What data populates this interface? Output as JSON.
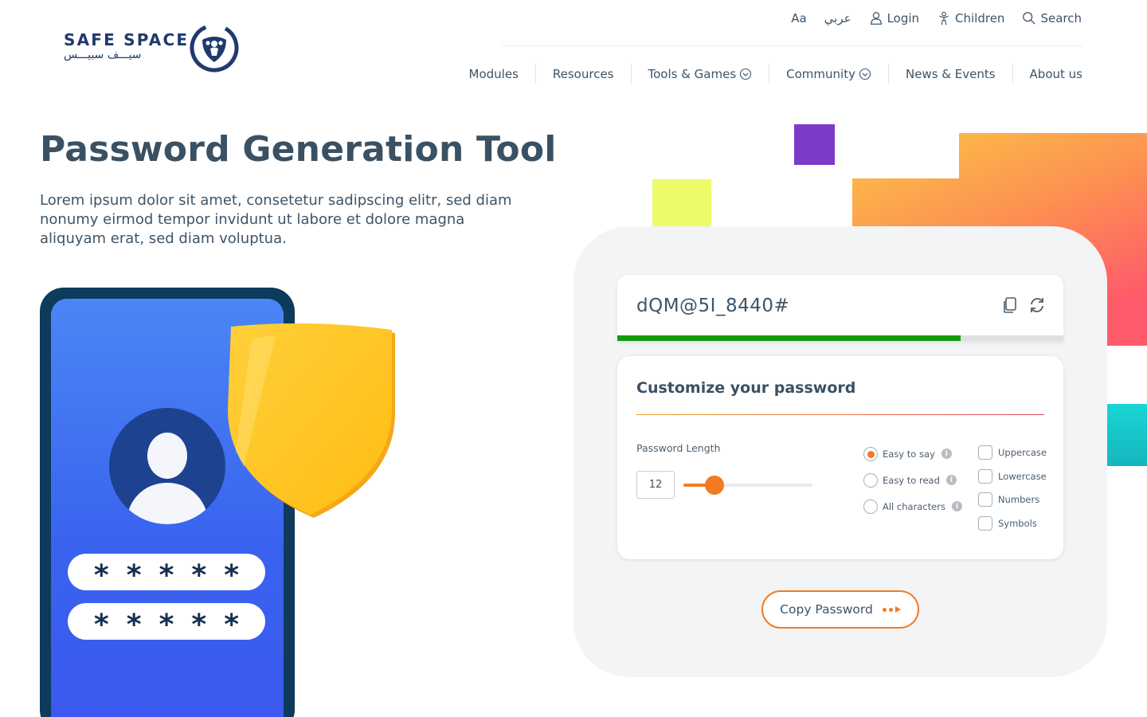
{
  "brand": {
    "name_en": "SAFE SPACE",
    "name_ar": "سيـــف سبيـــس"
  },
  "utility_nav": [
    {
      "label": "Aa",
      "icon": "font-size-icon"
    },
    {
      "label": "عربي",
      "icon": ""
    },
    {
      "label": "Login",
      "icon": "user-icon"
    },
    {
      "label": "Children",
      "icon": "child-icon"
    },
    {
      "label": "Search",
      "icon": "search-icon"
    }
  ],
  "main_nav": [
    {
      "label": "Modules",
      "dropdown": false
    },
    {
      "label": "Resources",
      "dropdown": false
    },
    {
      "label": "Tools & Games",
      "dropdown": true
    },
    {
      "label": "Community",
      "dropdown": true
    },
    {
      "label": "News & Events",
      "dropdown": false
    },
    {
      "label": "About us",
      "dropdown": false
    }
  ],
  "hero": {
    "title": "Password Generation Tool",
    "description": "Lorem ipsum dolor sit amet, consetetur sadipscing elitr, sed diam nonumy eirmod tempor invidunt ut labore et dolore magna aliquyam erat, sed diam voluptua."
  },
  "illustration": {
    "masked_password": "*****"
  },
  "generator": {
    "password": "dQM@5I_8440#",
    "strength_fraction": 0.77,
    "customize_title": "Customize your password",
    "length_label": "Password Length",
    "length_value": "12",
    "length_slider_fraction": 0.24,
    "modes": [
      {
        "label": "Easy to say",
        "selected": true
      },
      {
        "label": "Easy to read",
        "selected": false
      },
      {
        "label": "All characters",
        "selected": false
      }
    ],
    "char_options": [
      {
        "label": "Uppercase",
        "checked": false
      },
      {
        "label": "Lowercase",
        "checked": false
      },
      {
        "label": "Numbers",
        "checked": false
      },
      {
        "label": "Symbols",
        "checked": false
      }
    ],
    "copy_button": "Copy Password"
  },
  "colors": {
    "accent_orange": "#f17b22",
    "strength_green": "#139a0f",
    "brand_navy": "#1f3a6d"
  }
}
